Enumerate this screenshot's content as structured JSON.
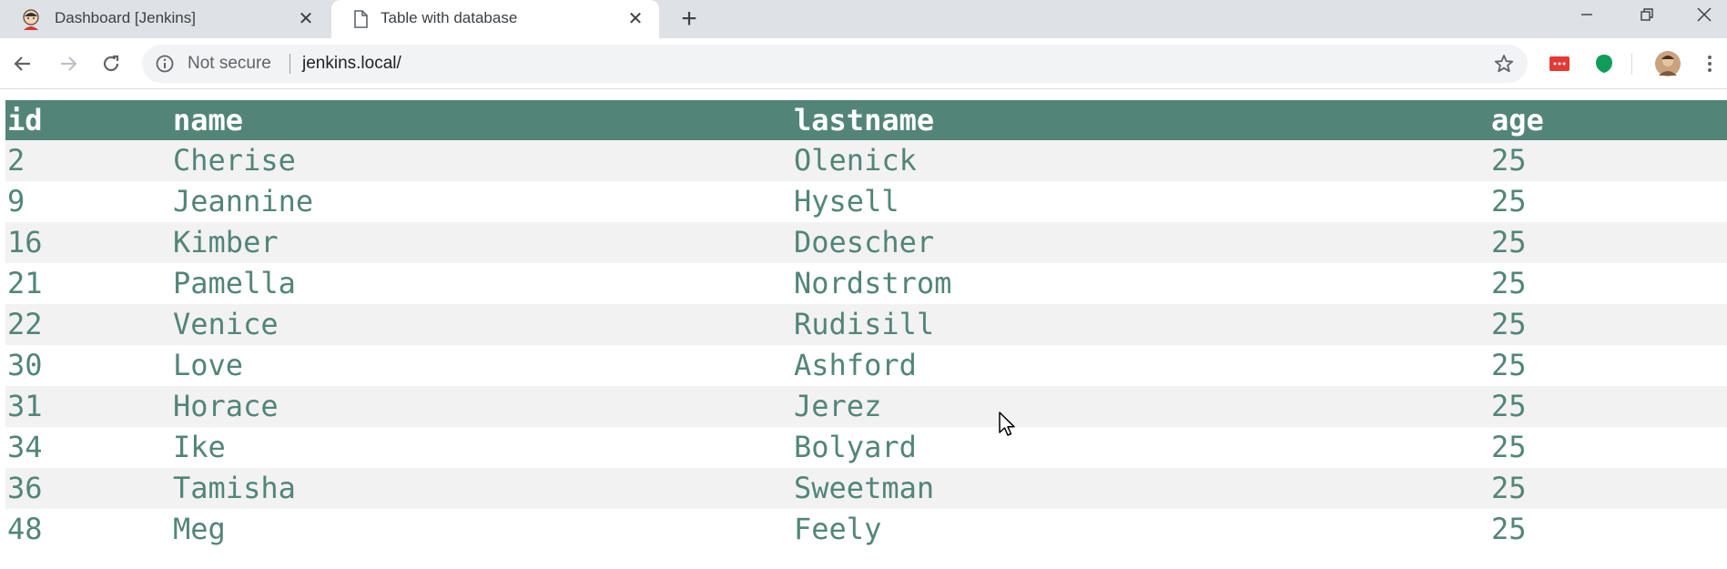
{
  "browser": {
    "tabs": [
      {
        "title": "Dashboard [Jenkins]",
        "icon": "jenkins-icon",
        "active": false
      },
      {
        "title": "Table with database",
        "icon": "document-icon",
        "active": true
      }
    ],
    "omnibox": {
      "security_label": "Not secure",
      "url": "jenkins.local/"
    },
    "extension_colors": {
      "red_extension": "#e53935",
      "green_extension": "#0f9d58"
    }
  },
  "table": {
    "header_color": "#528578",
    "text_color": "#528578",
    "headers": {
      "id": "id",
      "name": "name",
      "lastname": "lastname",
      "age": "age"
    },
    "rows": [
      {
        "id": "2",
        "name": "Cherise",
        "lastname": "Olenick",
        "age": "25"
      },
      {
        "id": "9",
        "name": "Jeannine",
        "lastname": "Hysell",
        "age": "25"
      },
      {
        "id": "16",
        "name": "Kimber",
        "lastname": "Doescher",
        "age": "25"
      },
      {
        "id": "21",
        "name": "Pamella",
        "lastname": "Nordstrom",
        "age": "25"
      },
      {
        "id": "22",
        "name": "Venice",
        "lastname": "Rudisill",
        "age": "25"
      },
      {
        "id": "30",
        "name": "Love",
        "lastname": "Ashford",
        "age": "25"
      },
      {
        "id": "31",
        "name": "Horace",
        "lastname": "Jerez",
        "age": "25"
      },
      {
        "id": "34",
        "name": "Ike",
        "lastname": "Bolyard",
        "age": "25"
      },
      {
        "id": "36",
        "name": "Tamisha",
        "lastname": "Sweetman",
        "age": "25"
      },
      {
        "id": "48",
        "name": "Meg",
        "lastname": "Feely",
        "age": "25"
      }
    ]
  }
}
